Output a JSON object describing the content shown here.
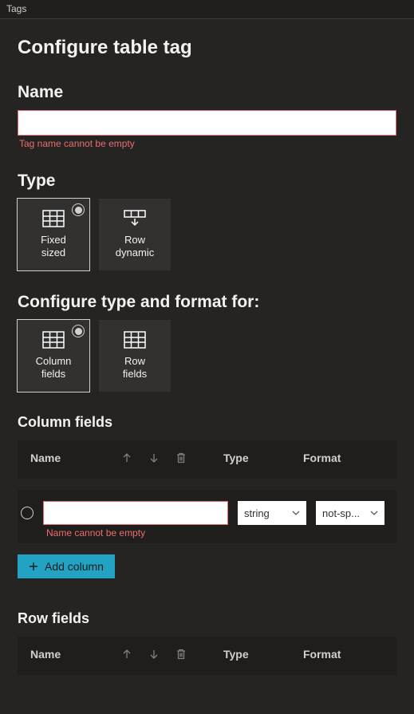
{
  "header": {
    "title": "Tags"
  },
  "page": {
    "title": "Configure table tag"
  },
  "name_section": {
    "label": "Name",
    "value": "",
    "error": "Tag name cannot be empty"
  },
  "type_section": {
    "label": "Type",
    "options": [
      {
        "id": "fixed",
        "label": "Fixed\nsized",
        "selected": true
      },
      {
        "id": "rowdyn",
        "label": "Row\ndynamic",
        "selected": false
      }
    ]
  },
  "format_for_section": {
    "label": "Configure type and format for:",
    "options": [
      {
        "id": "colfields",
        "label": "Column\nfields",
        "selected": true
      },
      {
        "id": "rowfields",
        "label": "Row\nfields",
        "selected": false
      }
    ]
  },
  "column_fields": {
    "heading": "Column fields",
    "head_name": "Name",
    "head_type": "Type",
    "head_format": "Format",
    "rows": [
      {
        "name": "",
        "name_error": "Name cannot be empty",
        "type": "string",
        "format": "not-sp..."
      }
    ],
    "add_label": "Add column"
  },
  "row_fields": {
    "heading": "Row fields",
    "head_name": "Name",
    "head_type": "Type",
    "head_format": "Format"
  }
}
